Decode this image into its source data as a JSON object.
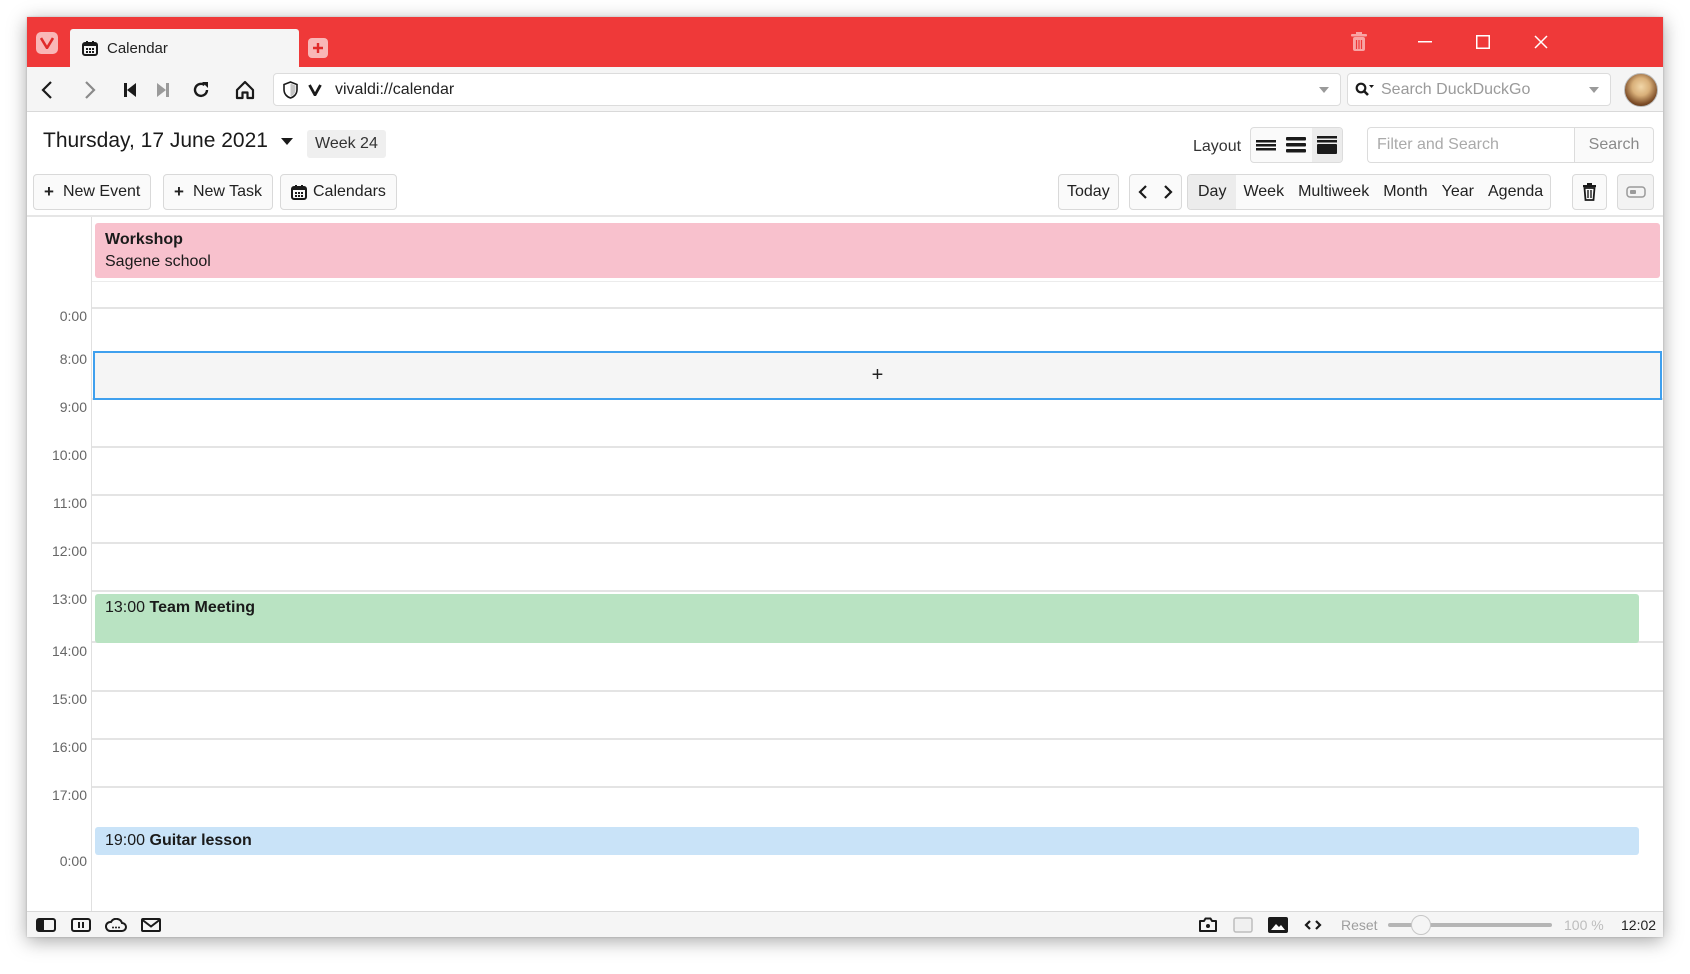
{
  "browser": {
    "tab_title": "Calendar",
    "url": "vivaldi://calendar",
    "search_placeholder": "Search DuckDuckGo",
    "brand_color": "#ef3939"
  },
  "calendar": {
    "date_title": "Thursday, 17 June 2021",
    "week_badge": "Week 24",
    "layout_label": "Layout",
    "filter_placeholder": "Filter and Search",
    "search_label": "Search",
    "new_event_label": "New Event",
    "new_task_label": "New Task",
    "calendars_label": "Calendars",
    "today_label": "Today",
    "views": [
      {
        "label": "Day",
        "active": true
      },
      {
        "label": "Week",
        "active": false
      },
      {
        "label": "Multiweek",
        "active": false
      },
      {
        "label": "Month",
        "active": false
      },
      {
        "label": "Year",
        "active": false
      },
      {
        "label": "Agenda",
        "active": false
      }
    ],
    "hour_labels": [
      {
        "label": "0:00"
      },
      {
        "label": "8:00"
      },
      {
        "label": "9:00"
      },
      {
        "label": "10:00"
      },
      {
        "label": "11:00"
      },
      {
        "label": "12:00"
      },
      {
        "label": "13:00"
      },
      {
        "label": "14:00"
      },
      {
        "label": "15:00"
      },
      {
        "label": "16:00"
      },
      {
        "label": "17:00"
      },
      {
        "label": "0:00"
      }
    ],
    "new_event_slot_symbol": "+",
    "events": {
      "workshop": {
        "title": "Workshop",
        "location": "Sagene school",
        "all_day": true,
        "color": "#f8c1cd"
      },
      "meeting": {
        "time": "13:00",
        "title": "Team Meeting",
        "color": "#b9e3c2"
      },
      "guitar": {
        "time": "19:00",
        "title": "Guitar lesson",
        "color": "#c9e3f8"
      }
    }
  },
  "statusbar": {
    "reset_label": "Reset",
    "zoom_value": "100 %",
    "zoom_level_fraction": 0.2,
    "clock": "12:02"
  }
}
